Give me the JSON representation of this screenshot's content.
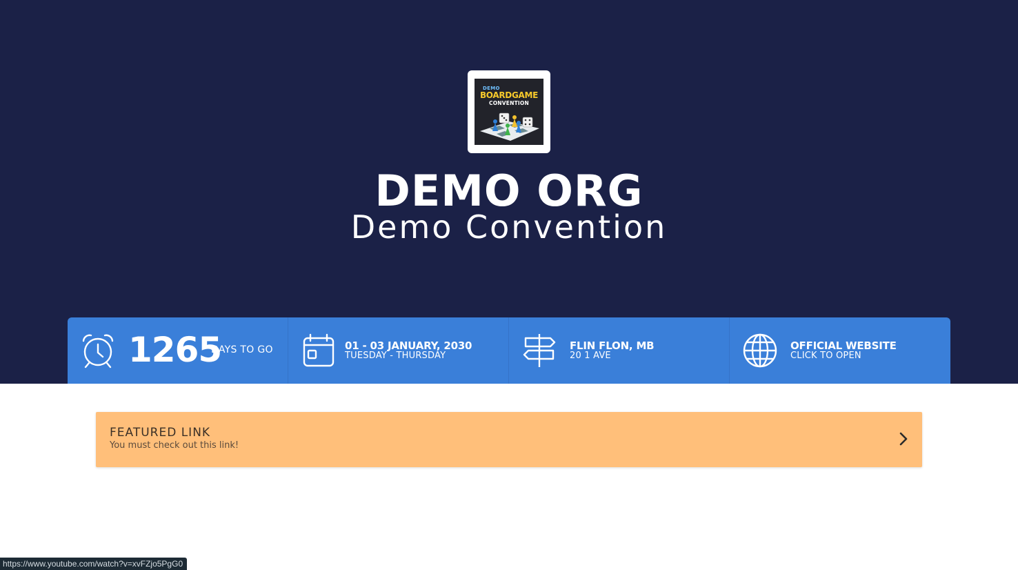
{
  "org": {
    "name": "DEMO ORG",
    "convention": "Demo Convention"
  },
  "logo": {
    "demo": "DEMO",
    "title": "BOARDGAME",
    "subtitle": "CONVENTION"
  },
  "countdown": {
    "value": "1265",
    "label": "DAYS TO GO",
    "icon": "alarm-clock-icon"
  },
  "dates": {
    "range": "01 - 03 JANUARY, 2030",
    "days": "TUESDAY - THURSDAY",
    "icon": "calendar-icon"
  },
  "location": {
    "city": "FLIN FLON, MB",
    "address": "20 1 AVE",
    "icon": "signpost-icon"
  },
  "website": {
    "label": "OFFICIAL WEBSITE",
    "action": "CLICK TO OPEN",
    "icon": "globe-icon"
  },
  "featured": {
    "title": "FEATURED LINK",
    "subtitle": "You must check out this link!",
    "icon": "chevron-right-icon"
  },
  "status_bar": {
    "url": "https://www.youtube.com/watch?v=xvFZjo5PgG0"
  },
  "colors": {
    "hero_bg": "#1b2147",
    "infobar_bg": "#3a7fd9",
    "featured_bg": "#ffbf7a"
  }
}
